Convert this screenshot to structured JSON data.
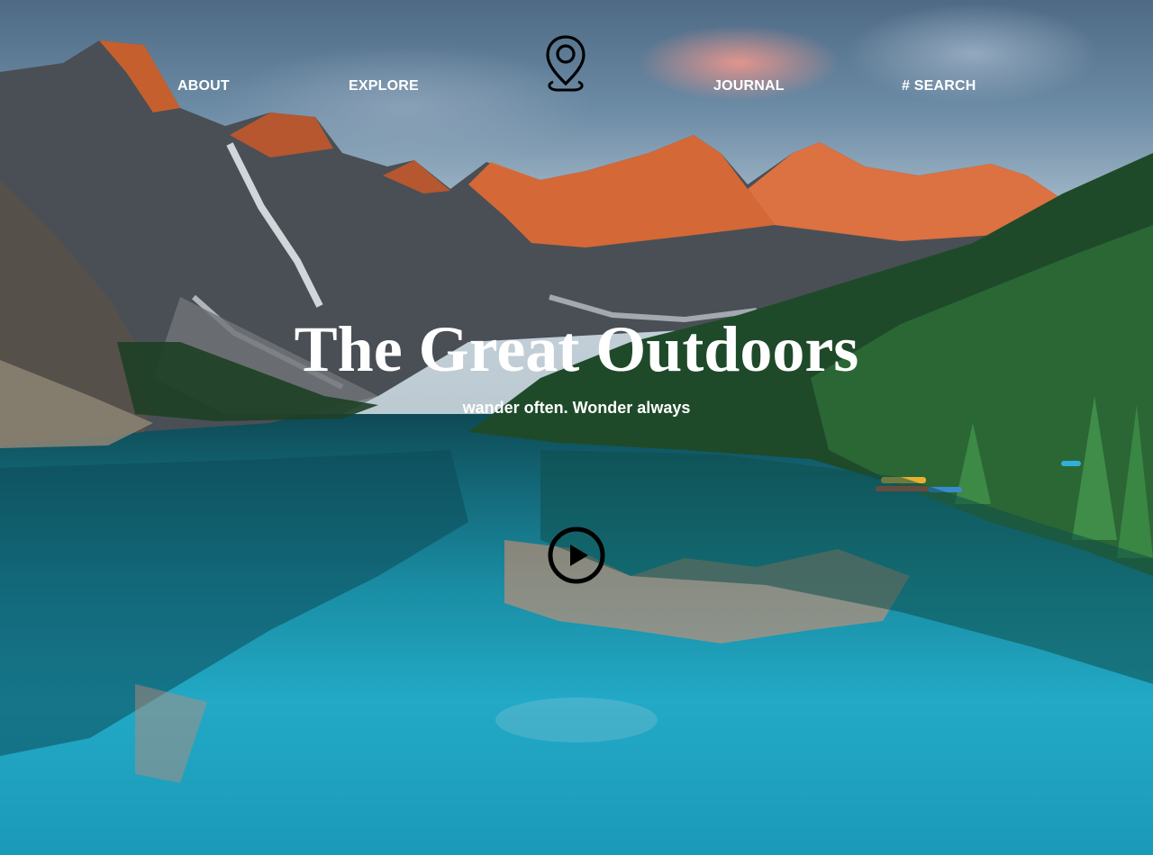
{
  "nav": {
    "items": [
      {
        "label": "ABOUT"
      },
      {
        "label": "EXPLORE"
      },
      {
        "label": "JOURNAL"
      },
      {
        "label": "# SEARCH"
      }
    ],
    "logo_icon": "map-pin-icon"
  },
  "hero": {
    "title": "The Great Outdoors",
    "subtitle": "wander often. Wonder always",
    "play_icon": "play-circle-icon",
    "background": "mountain-lake-image"
  },
  "colors": {
    "text": "#ffffff",
    "icon": "#000000"
  }
}
